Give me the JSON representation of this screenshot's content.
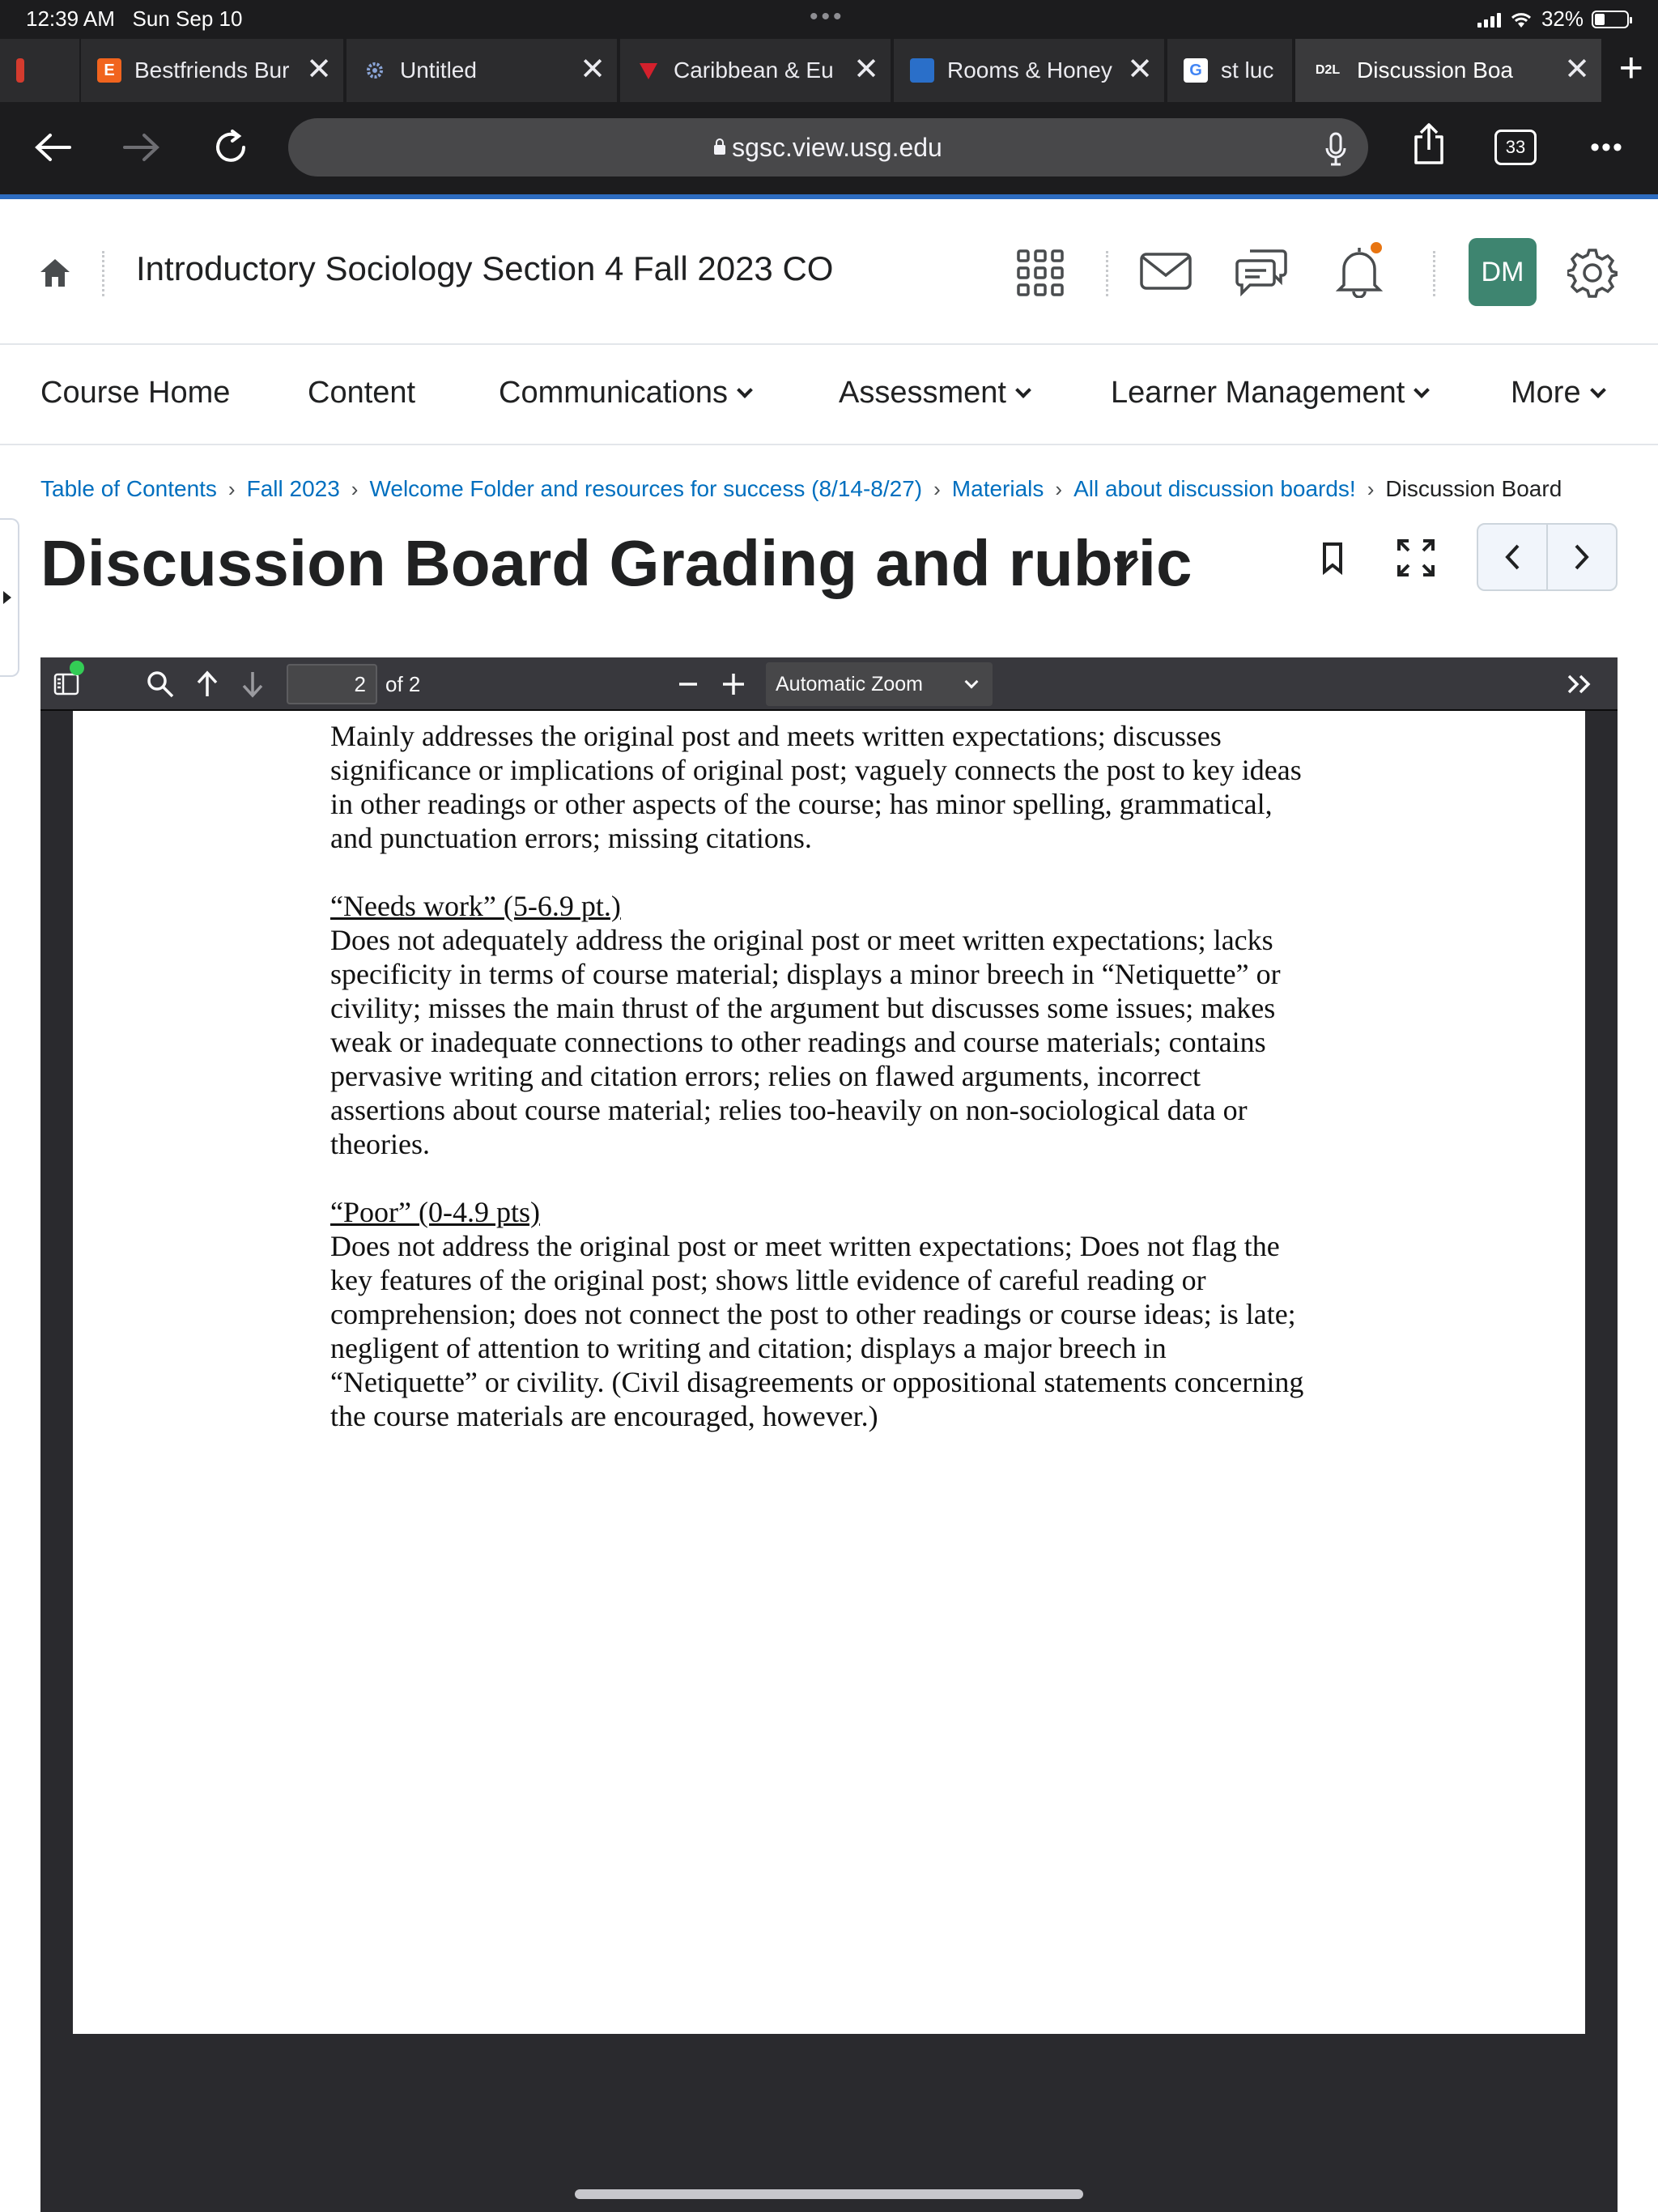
{
  "status_bar": {
    "time": "12:39 AM",
    "date": "Sun Sep 10",
    "battery": "32%"
  },
  "browser": {
    "tabs": [
      {
        "label": "Bestfriends Bur",
        "favicon": "E"
      },
      {
        "label": "Untitled",
        "favicon": ""
      },
      {
        "label": "Caribbean & Eu",
        "favicon": ""
      },
      {
        "label": "Rooms & Honey",
        "favicon": ""
      },
      {
        "label": "st luc",
        "favicon": "G"
      },
      {
        "label": "Discussion Boa",
        "favicon": "D2L"
      }
    ],
    "url": "sgsc.view.usg.edu",
    "tab_count": "33"
  },
  "header": {
    "course_title": "Introductory Sociology Section 4 Fall 2023 CO",
    "avatar_initials": "DM",
    "accent_color": "#3e8570"
  },
  "nav": {
    "items": [
      {
        "label": "Course Home"
      },
      {
        "label": "Content"
      },
      {
        "label": "Communications"
      },
      {
        "label": "Assessment"
      },
      {
        "label": "Learner Management"
      },
      {
        "label": "More"
      }
    ]
  },
  "breadcrumb": {
    "items": [
      "Table of Contents",
      "Fall 2023",
      "Welcome Folder and resources for success (8/14-8/27)",
      "Materials",
      "All about discussion boards!"
    ],
    "current": "Discussion Board"
  },
  "page": {
    "title": "Discussion Board Grading and rubric"
  },
  "pdf_viewer": {
    "page_number": "2",
    "page_count": "of 2",
    "zoom": "Automatic Zoom"
  },
  "document": {
    "intro": "Mainly addresses the original post and meets written expectations; discusses significance or implications of original post; vaguely connects the post to key ideas in other readings or other aspects of the course; has minor spelling, grammatical, and punctuation errors; missing citations.",
    "sections": [
      {
        "heading": "“Needs work” (5-6.9 pt.)",
        "body": "Does not adequately address the original post or meet written expectations; lacks specificity in terms of course material; displays a minor breech in “Netiquette” or civility; misses the main thrust of the argument but discusses some issues; makes weak or inadequate connections to other readings and course materials; contains pervasive writing and citation errors; relies on flawed arguments, incorrect assertions about course material; relies too-heavily on non-sociological data or theories."
      },
      {
        "heading": "“Poor” (0-4.9 pts)",
        "body": "Does not address the original post or meet written expectations; Does not flag the key features of the original post; shows little evidence of careful reading or comprehension; does not connect the post to other readings or course ideas; is late; negligent of attention to writing and citation; displays a major breech in “Netiquette” or civility. (Civil disagreements or oppositional statements concerning the course materials are encouraged, however.)"
      }
    ]
  }
}
